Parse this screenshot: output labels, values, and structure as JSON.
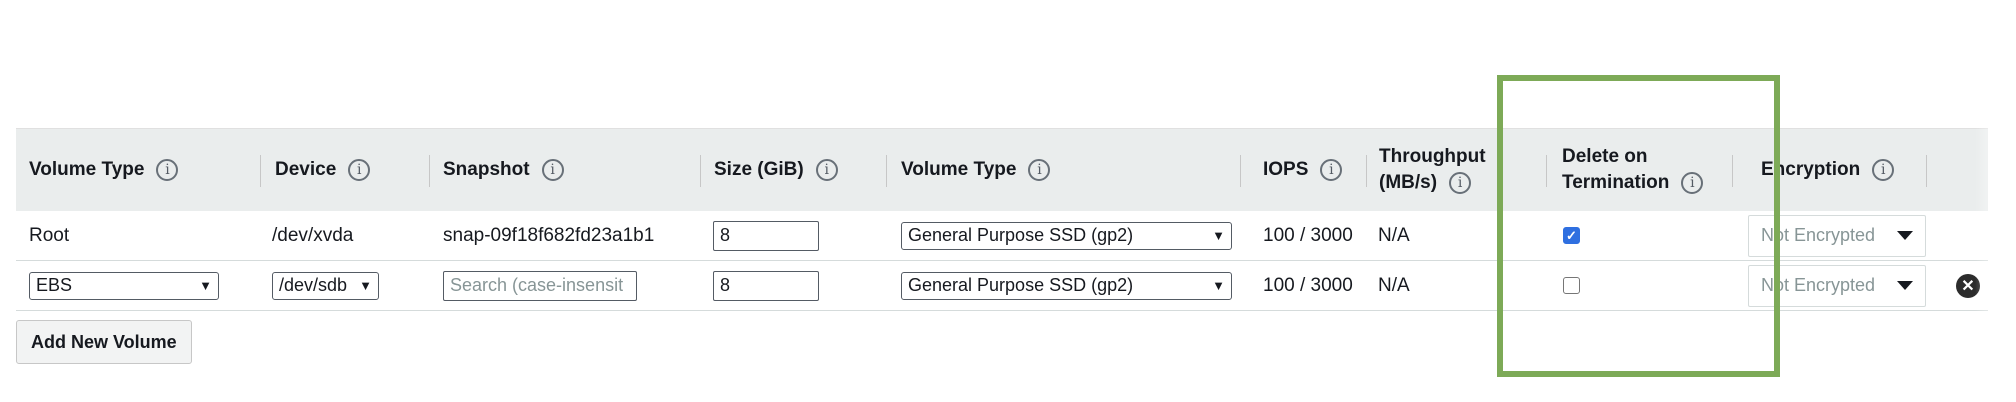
{
  "columns": {
    "volume_type": "Volume Type",
    "device": "Device",
    "snapshot": "Snapshot",
    "size": "Size (GiB)",
    "volume_type2": "Volume Type",
    "iops": "IOPS",
    "throughput_line1": "Throughput",
    "throughput_line2": "(MB/s)",
    "delete_line1": "Delete on",
    "delete_line2": "Termination",
    "encryption": "Encryption"
  },
  "info_glyph": "i",
  "rows": [
    {
      "volume_type": "Root",
      "device": "/dev/xvda",
      "snapshot": "snap-09f18f682fd23a1b1",
      "size": "8",
      "ebs_volume_type": "General Purpose SSD (gp2)",
      "iops": "100 / 3000",
      "throughput": "N/A",
      "delete_on_termination": true,
      "encryption": "Not Encrypted"
    },
    {
      "volume_type": "EBS",
      "device": "/dev/sdb",
      "snapshot_placeholder": "Search (case-insensit",
      "size": "8",
      "ebs_volume_type": "General Purpose SSD (gp2)",
      "iops": "100 / 3000",
      "throughput": "N/A",
      "delete_on_termination": false,
      "encryption": "Not Encrypted"
    }
  ],
  "add_button": "Add New Volume",
  "colors": {
    "header_bg": "#eaeded",
    "highlight": "#7daa57",
    "checkbox_checked": "#2f6fe0"
  },
  "icons": {
    "info": "info-icon",
    "dropdown": "chevron-down-icon",
    "remove": "close-circle-icon",
    "checkmark": "checkmark-icon"
  }
}
